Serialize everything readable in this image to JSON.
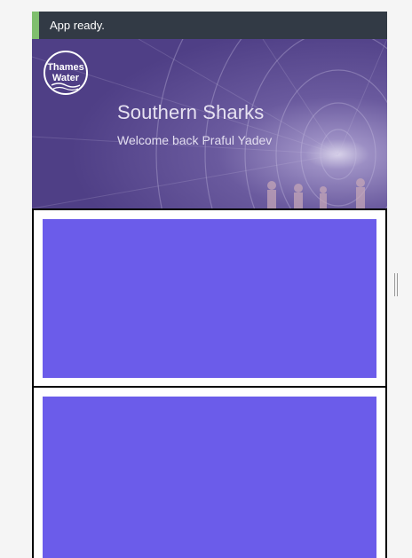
{
  "status": {
    "message": "App ready.",
    "accent_color": "#7fbf6e",
    "background_color": "#323a45"
  },
  "header": {
    "logo": {
      "line1": "Thames",
      "line2": "Water",
      "icon": "thames-water-logo"
    },
    "title": "Southern Sharks",
    "subtitle": "Welcome back Praful Yadev",
    "overlay_color": "#5a4a8c"
  },
  "cards": [
    {
      "name": "card-1",
      "color": "#6b5cea"
    },
    {
      "name": "card-2",
      "color": "#6b5cea"
    }
  ],
  "resize_handle": {
    "icon": "drag-handle-icon"
  }
}
